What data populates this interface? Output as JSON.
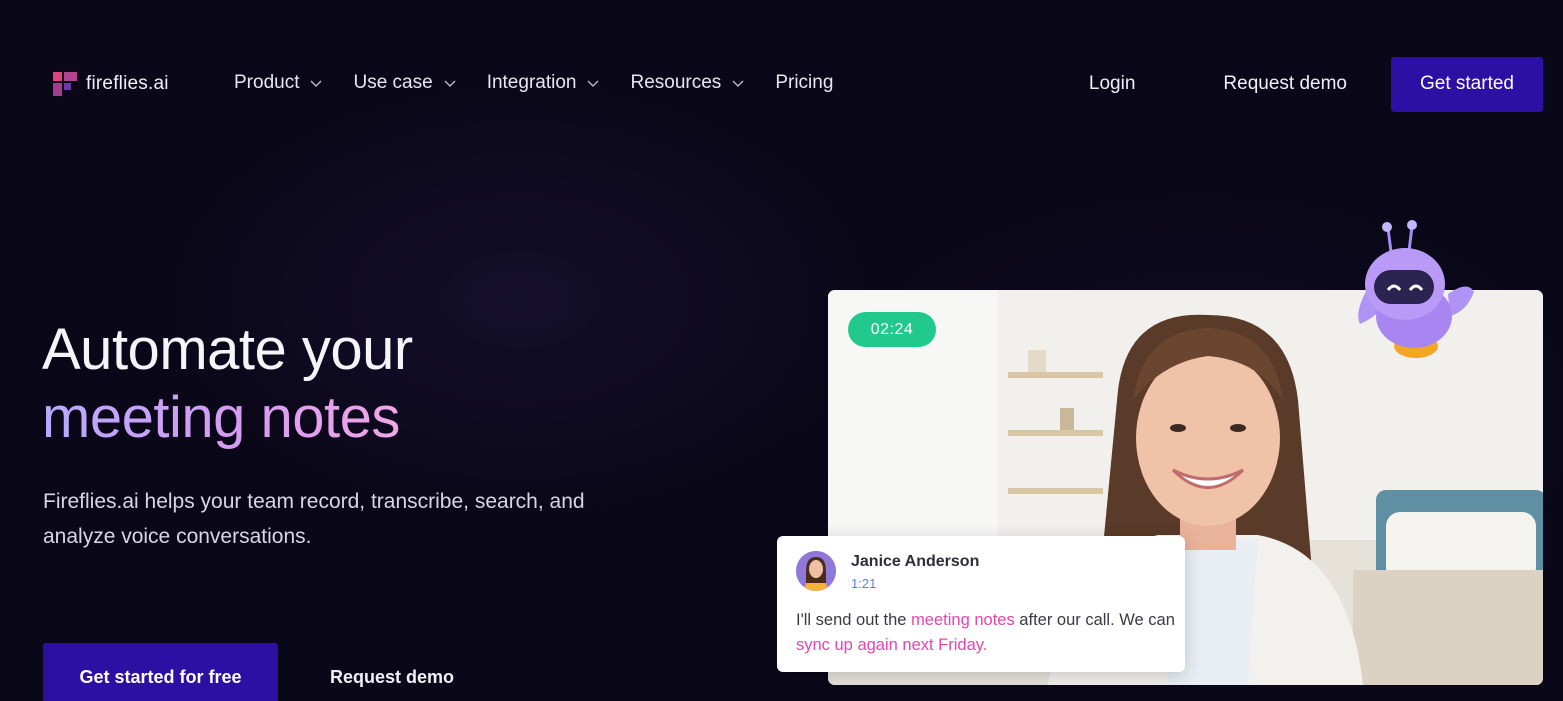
{
  "brand": {
    "name": "fireflies.ai",
    "logo_icon": "fireflies-logo-icon",
    "accent": "#2c10a3"
  },
  "nav": {
    "menu": [
      {
        "label": "Product",
        "has_dropdown": true
      },
      {
        "label": "Use case",
        "has_dropdown": true
      },
      {
        "label": "Integration",
        "has_dropdown": true
      },
      {
        "label": "Resources",
        "has_dropdown": true
      },
      {
        "label": "Pricing",
        "has_dropdown": false
      }
    ],
    "login_label": "Login",
    "request_demo_label": "Request demo",
    "get_started_label": "Get started"
  },
  "hero": {
    "title_line1": "Automate your",
    "title_line2": "meeting notes",
    "subtitle": "Fireflies.ai helps your team record, transcribe, search, and analyze voice conversations.",
    "cta_primary": "Get started for free",
    "cta_secondary": "Request demo"
  },
  "video": {
    "timer": "02:24",
    "timer_color": "#21c98e"
  },
  "transcript": {
    "speaker": "Janice Anderson",
    "timestamp": "1:21",
    "text_part1": "I'll send out the ",
    "highlight1": "meeting notes",
    "text_part2": " after our call. We can ",
    "highlight2": "sync up again next Friday.",
    "highlight_color": "#e246b0"
  }
}
